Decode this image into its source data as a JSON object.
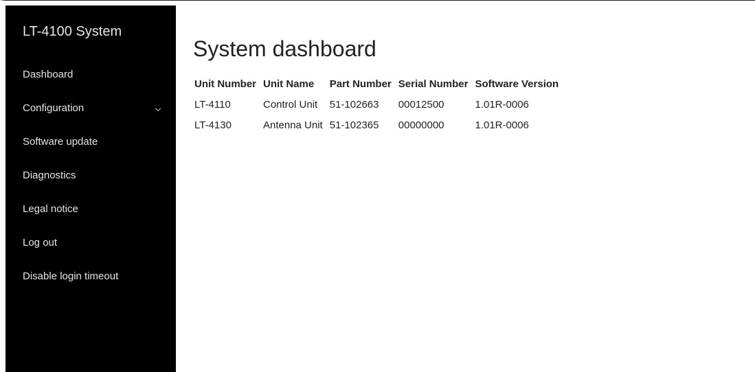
{
  "sidebar": {
    "brand": "LT-4100 System",
    "items": [
      {
        "label": "Dashboard"
      },
      {
        "label": "Configuration"
      },
      {
        "label": "Software update"
      },
      {
        "label": "Diagnostics"
      },
      {
        "label": "Legal notice"
      },
      {
        "label": "Log out"
      },
      {
        "label": "Disable login timeout"
      }
    ]
  },
  "main": {
    "title": "System dashboard",
    "table": {
      "headers": [
        "Unit Number",
        "Unit Name",
        "Part Number",
        "Serial Number",
        "Software Version"
      ],
      "rows": [
        [
          "LT-4110",
          "Control Unit",
          "51-102663",
          "00012500",
          "1.01R-0006"
        ],
        [
          "LT-4130",
          "Antenna Unit",
          "51-102365",
          "00000000",
          "1.01R-0006"
        ]
      ]
    }
  },
  "colors": {
    "sidebar_bg": "#000000",
    "sidebar_text": "#e6e6e6",
    "content_bg": "#ffffff",
    "content_text": "#222222"
  },
  "icons": {
    "configuration_expand": "chevron-down-icon"
  }
}
